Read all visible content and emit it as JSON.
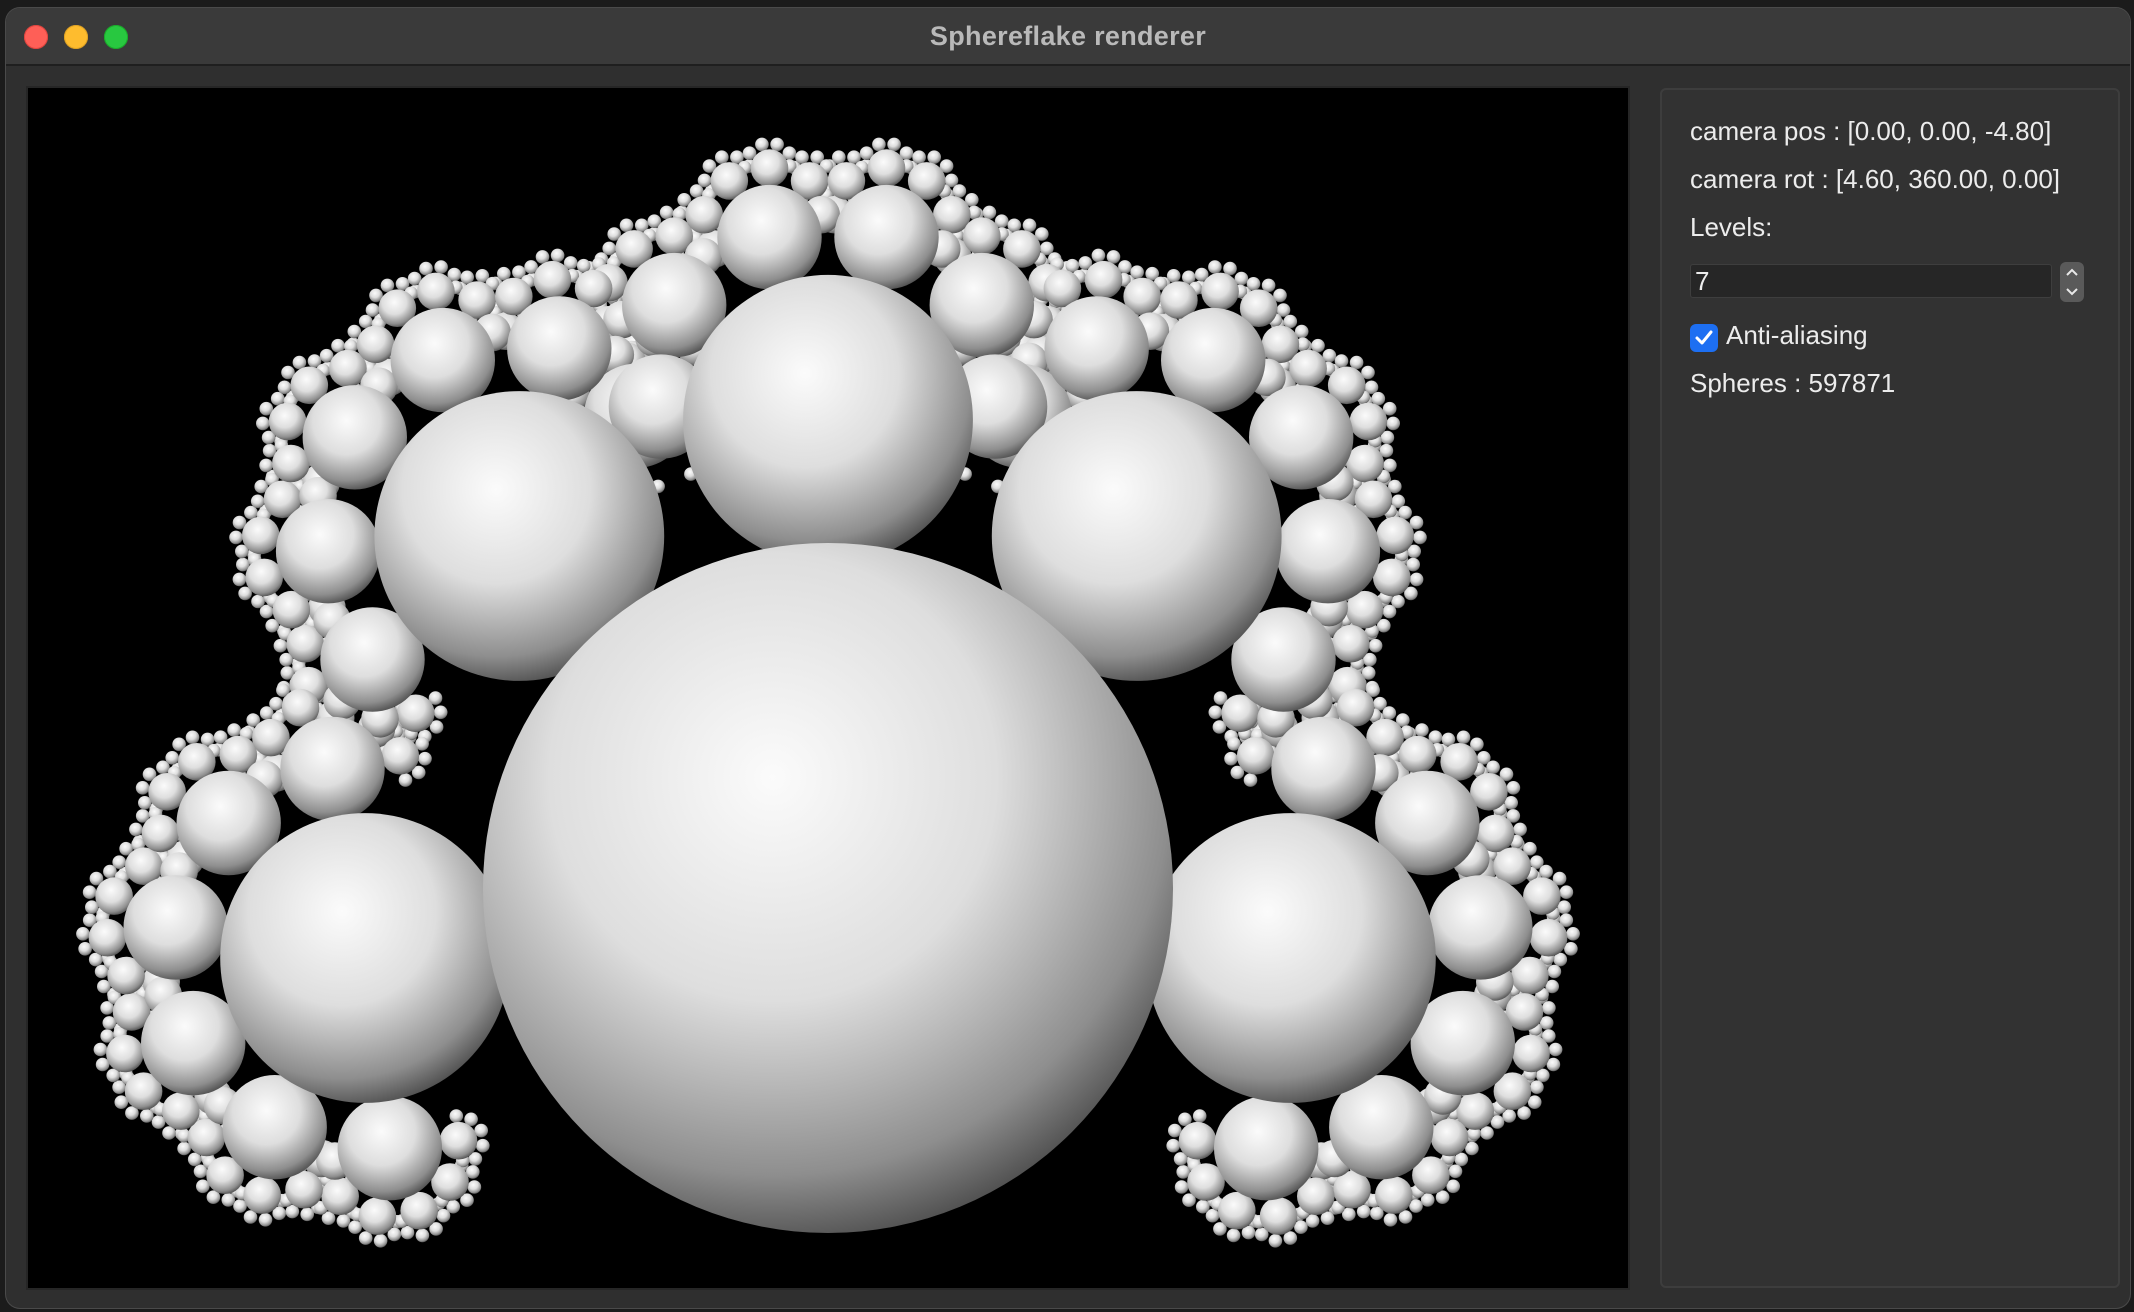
{
  "window": {
    "title": "Sphereflake renderer"
  },
  "panel": {
    "camera_pos": "camera pos : [0.00, 0.00, -4.80]",
    "camera_rot": "camera rot : [4.60, 360.00, 0.00]",
    "levels_label": "Levels:",
    "levels_value": "7",
    "antialiasing_label": "Anti-aliasing",
    "antialiasing_checked": true,
    "spheres_count": "Spheres : 597871"
  },
  "icons": {
    "close": "close-dot-icon",
    "minimize": "minimize-dot-icon",
    "zoom": "zoom-dot-icon",
    "spin_up": "chevron-up-icon",
    "spin_down": "chevron-down-icon",
    "checkmark": "checkmark-icon"
  },
  "colors": {
    "close": "#fe5f57",
    "minimize": "#febc2e",
    "zoom": "#28c840",
    "checkbox_accent": "#1d6ff2"
  }
}
